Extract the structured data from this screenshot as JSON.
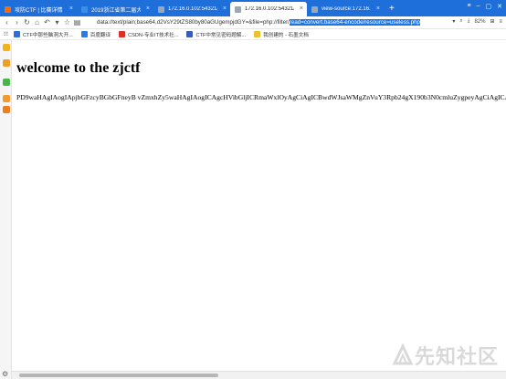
{
  "tabs": [
    {
      "label": "攻防CTF | 比赛详情",
      "icon_color": "#ff6a00",
      "active": false
    },
    {
      "label": "2019浙江省第二届大学生网",
      "icon_color": "#3a8ee6",
      "active": false
    },
    {
      "label": "172.16.0.102:54321/?g/Ufyh",
      "icon_color": "#9aa7b5",
      "active": false
    },
    {
      "label": "172.16.0.102:54321/?g/Ufyh",
      "icon_color": "#9aa7b5",
      "active": true
    },
    {
      "label": "view-source:172.16.0.102:5",
      "icon_color": "#9aa7b5",
      "active": false
    }
  ],
  "new_tab_label": "+",
  "address": {
    "url_prefix": "data://text/plain;base64,d2VsY29tZS80by80aGUgempjdGY=&file=php://filter/",
    "url_selected": "read=convert.base64-encode/resource=useless.php",
    "zoom": "82%"
  },
  "bookmarks": [
    {
      "label": "CTF中那些脑洞大开...",
      "icon": "ctf-bookmark-icon",
      "color": "#2f6fd6"
    },
    {
      "label": "百度翻译",
      "icon": "baidu-translate-icon",
      "color": "#2c7be5"
    },
    {
      "label": "CSDN-专业IT技术社...",
      "icon": "csdn-icon",
      "color": "#d9302b"
    },
    {
      "label": "CTF中常见密码题解...",
      "icon": "ctf-crypto-icon",
      "color": "#3b5bb5"
    },
    {
      "label": "我创建的 - 石墨文档",
      "icon": "shimo-icon",
      "color": "#e8c230"
    }
  ],
  "page": {
    "heading": "welcome to the zjctf",
    "payload": "PD9waHAgIAogIApjbGFzcyBGbGFneyB vZmxhZy5waHAgIAogICAgcHVibGljICRmaWxlOyAgCiAgICBwdWJsaWMgZnVuY3Rpb24gX190b3N0cmluZygpeyAgCiAgICAgICAgIGlmKGlzc2V0KCR0aGlzLT5maWxlKSl7ICAKICAgICAgICAgICAgZWNobyBmaWxlX2dldF9jb250ZW50cygk"
  },
  "watermark": "先知社区",
  "colors": {
    "tabbar": "#1e6fd9",
    "selection": "#1c76e6"
  }
}
